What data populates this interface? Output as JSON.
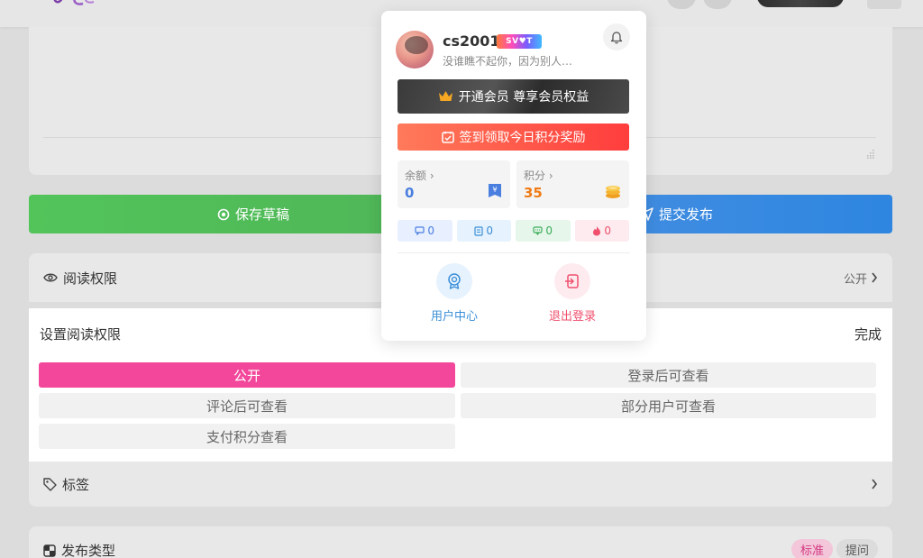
{
  "header": {},
  "editor": {},
  "buttons": {
    "save_label": "保存草稿",
    "submit_label": "提交发布"
  },
  "read_permission": {
    "label": "阅读权限",
    "value": "公开"
  },
  "permission_panel": {
    "title": "设置阅读权限",
    "done_label": "完成",
    "options": [
      {
        "label": "公开",
        "active": true
      },
      {
        "label": "登录后可查看",
        "active": false
      },
      {
        "label": "评论后可查看",
        "active": false
      },
      {
        "label": "部分用户可查看",
        "active": false
      },
      {
        "label": "支付积分查看",
        "active": false
      }
    ]
  },
  "tags": {
    "label": "标签"
  },
  "publish_type": {
    "label": "发布类型",
    "tabs": [
      "标准",
      "提问"
    ]
  },
  "user_menu": {
    "username": "cs2001",
    "vip_badge": "SV♥T",
    "signature": "没谁瞧不起你，因为别人…",
    "vip_button": "开通会员 尊享会员权益",
    "sign_button": "签到领取今日积分奖励",
    "balance": {
      "label": "余额 ›",
      "value": "0",
      "color": "#4a7fe0"
    },
    "points": {
      "label": "积分 ›",
      "value": "35",
      "color": "#f07b14"
    },
    "counts": [
      {
        "value": "0",
        "icon": "comment-icon",
        "color": "#4a7fe0",
        "bg": "#e8efff"
      },
      {
        "value": "0",
        "icon": "post-icon",
        "color": "#3b8fd9",
        "bg": "#e6f2fd"
      },
      {
        "value": "0",
        "icon": "message-icon",
        "color": "#3cae5a",
        "bg": "#e6f6ea"
      },
      {
        "value": "0",
        "icon": "fire-icon",
        "color": "#f0506e",
        "bg": "#fdebef"
      }
    ],
    "user_center_label": "用户中心",
    "logout_label": "退出登录"
  },
  "colors": {
    "save_green": "#52c45a",
    "submit_blue": "#2e86e0",
    "active_pink": "#f2479a"
  }
}
